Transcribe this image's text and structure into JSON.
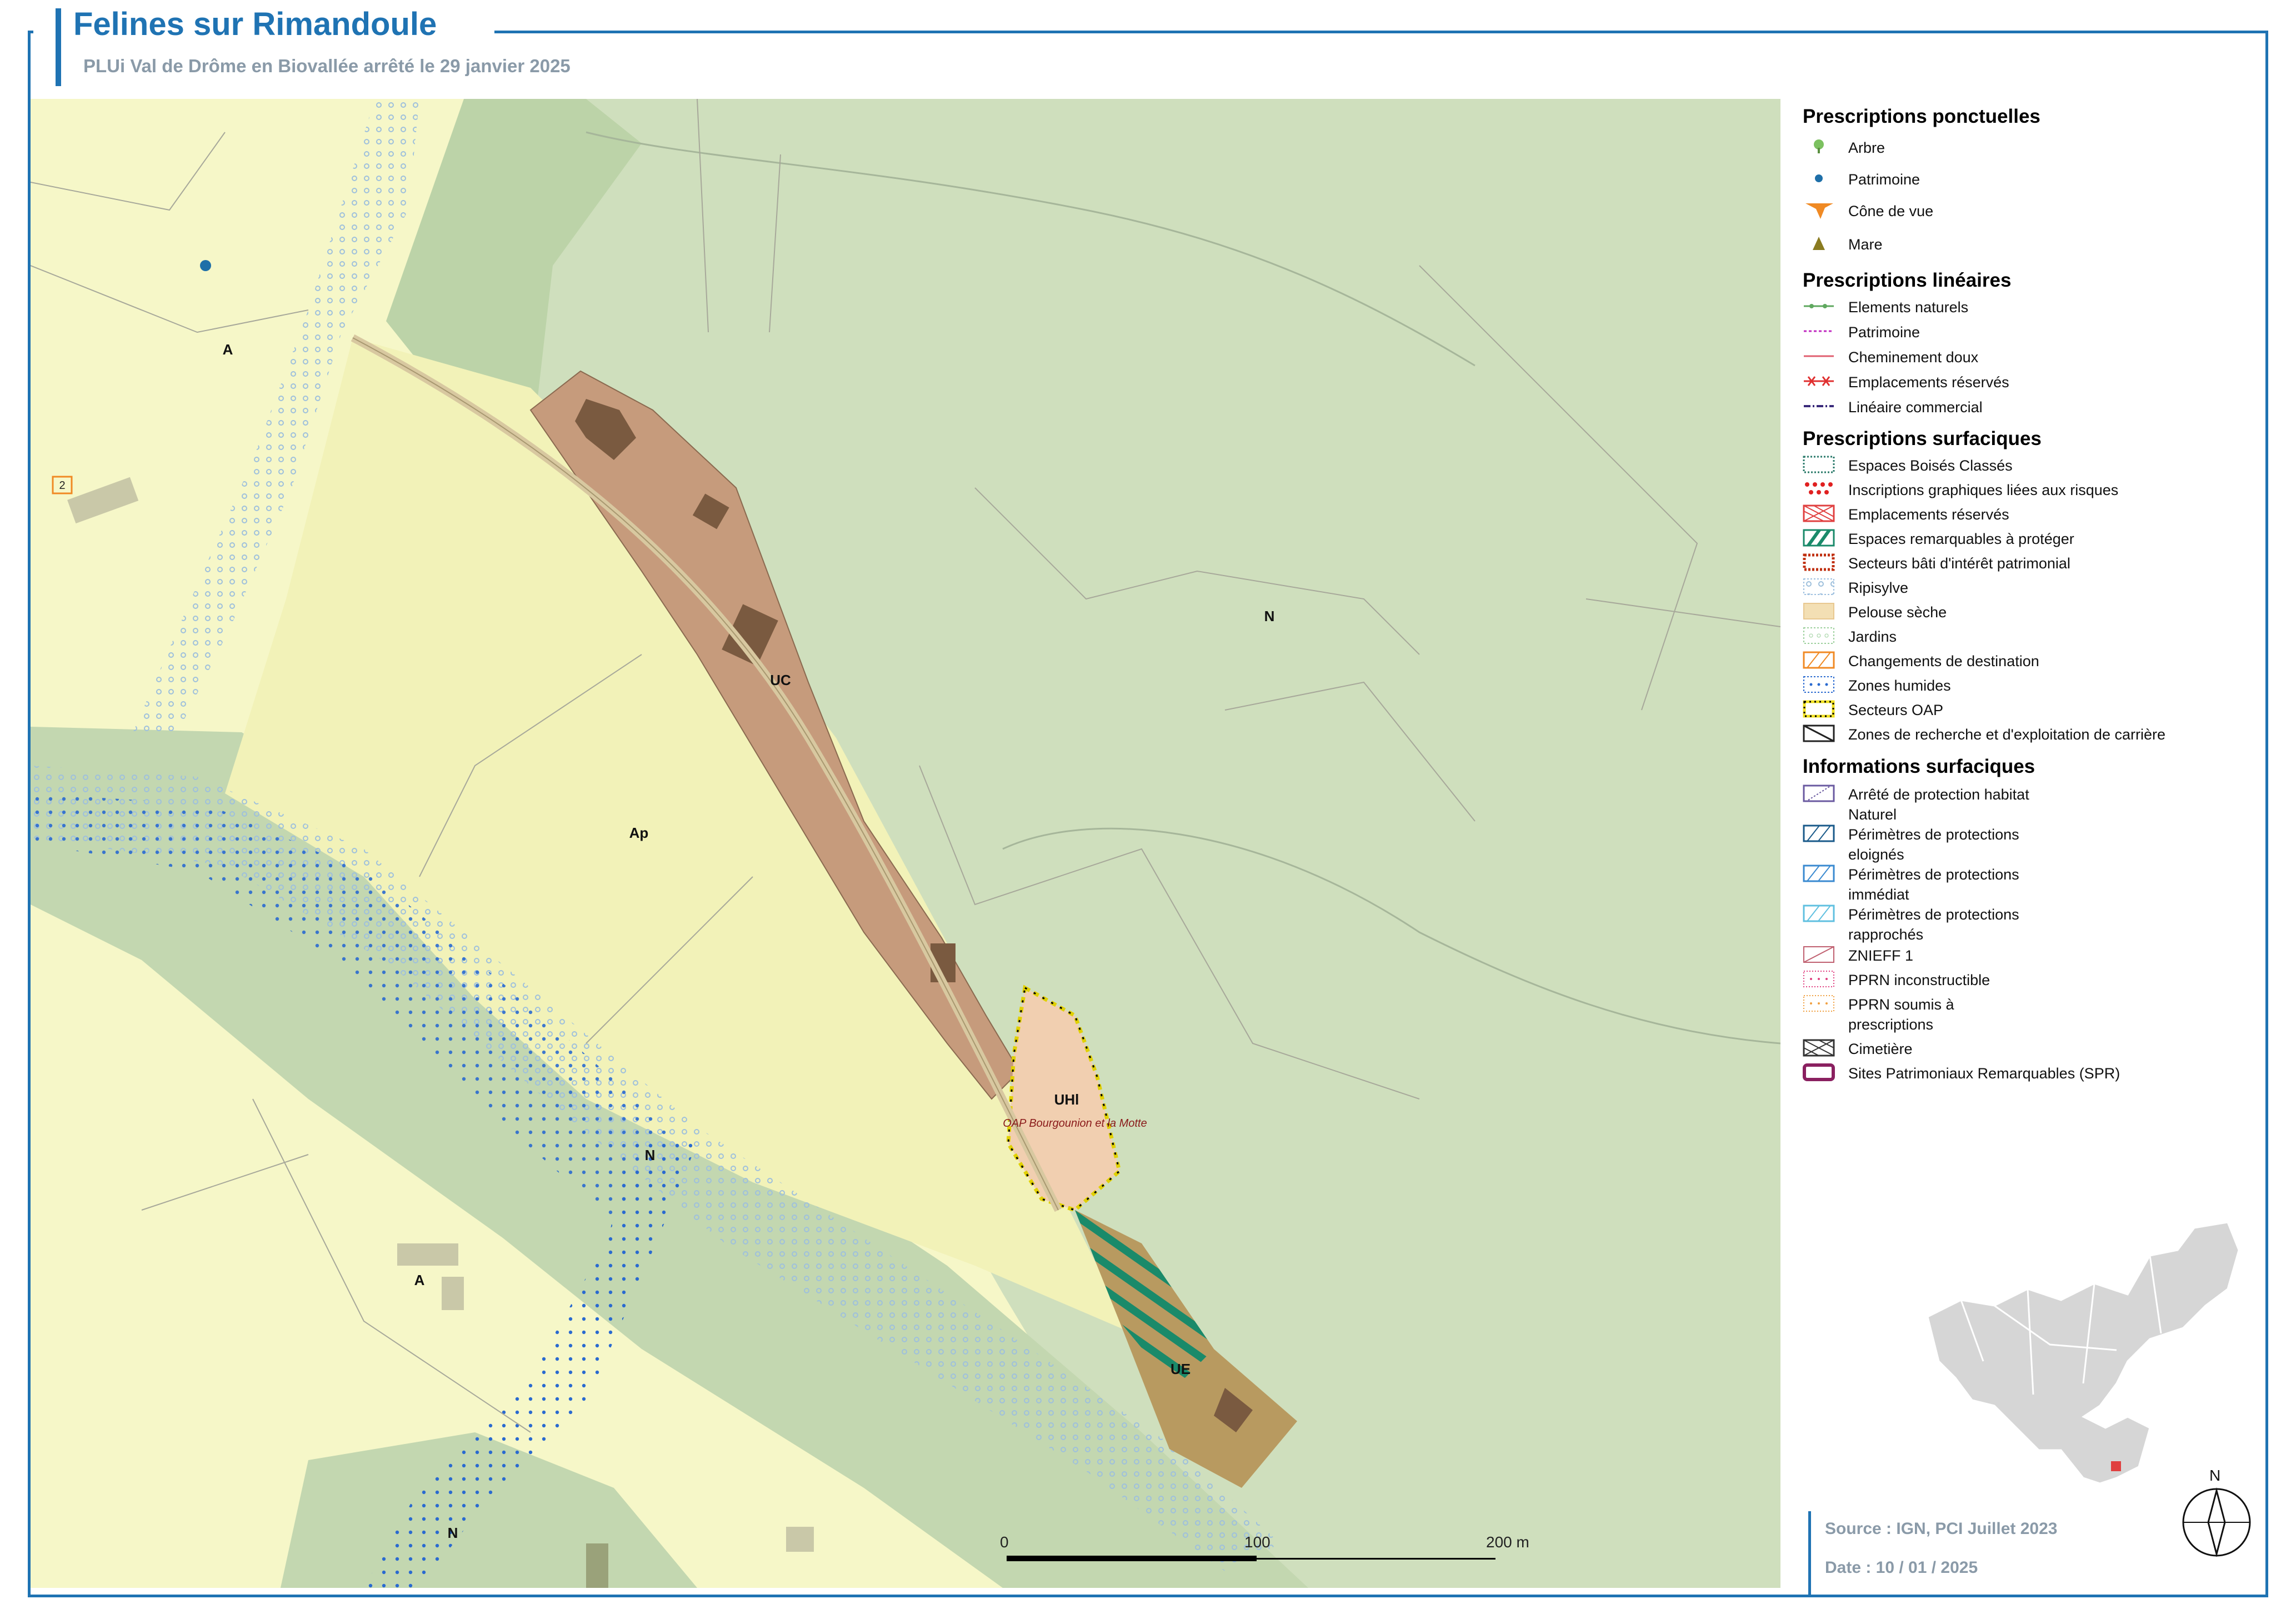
{
  "header": {
    "title": "Felines sur Rimandoule",
    "subtitle": "PLUi Val de Drôme en Biovallée arrêté le 29 janvier 2025"
  },
  "map": {
    "zones": [
      {
        "code": "A",
        "color": "#f6f7c8"
      },
      {
        "code": "Ap",
        "color": "#f2f2b8"
      },
      {
        "code": "N",
        "color": "#cfdfbd"
      },
      {
        "code": "UC",
        "color": "#c69b7c"
      },
      {
        "code": "UHl",
        "color": "#f1cfb0"
      },
      {
        "code": "UE",
        "color": "#b89a60"
      }
    ],
    "zone_labels": [
      "A",
      "A",
      "Ap",
      "N",
      "N",
      "N",
      "UC",
      "UHl",
      "UE"
    ],
    "oap_label": "OAP Bourgounion et la Motte",
    "parcel_badge": "2",
    "scale": {
      "labels": [
        "0",
        "100",
        "200 m"
      ]
    }
  },
  "legend": {
    "sections": [
      {
        "title": "Prescriptions ponctuelles",
        "items": [
          {
            "label": "Arbre",
            "icon": "tree-icon",
            "color": "#7cc160"
          },
          {
            "label": "Patrimoine",
            "icon": "dot-icon",
            "color": "#1e6fa8"
          },
          {
            "label": "Cône de vue",
            "icon": "view-cone-icon",
            "color": "#f08a24"
          },
          {
            "label": "Mare",
            "icon": "triangle-icon",
            "color": "#8a7b20"
          }
        ]
      },
      {
        "title": "Prescriptions linéaires",
        "items": [
          {
            "label": "Elements naturels",
            "icon": "line-dotted-icon",
            "color": "#5fa85f"
          },
          {
            "label": "Patrimoine",
            "icon": "line-dashed-icon",
            "color": "#c02cc0"
          },
          {
            "label": "Cheminement doux",
            "icon": "line-solid-icon",
            "color": "#e06070"
          },
          {
            "label": "Emplacements réservés",
            "icon": "line-cross-icon",
            "color": "#e03030"
          },
          {
            "label": "Linéaire commercial",
            "icon": "line-dashdot-icon",
            "color": "#3a2a7a"
          }
        ]
      },
      {
        "title": "Prescriptions surfaciques",
        "items": [
          {
            "label": "Espaces Boisés Classés",
            "icon": "ebc-icon",
            "color": "#2a7a6a"
          },
          {
            "label": "Inscriptions graphiques liées aux risques",
            "icon": "risk-dots-icon",
            "color": "#e02020"
          },
          {
            "label": "Emplacements réservés",
            "icon": "reserved-cross-icon",
            "color": "#e04040"
          },
          {
            "label": "Espaces remarquables à protéger",
            "icon": "remarkable-hatch-icon",
            "color": "#1a8a6a"
          },
          {
            "label": "Secteurs bâti d'intérêt patrimonial",
            "icon": "heritage-sector-icon",
            "color": "#c03010"
          },
          {
            "label": "Ripisylve",
            "icon": "ripisylve-icon",
            "color": "#9ec0e0"
          },
          {
            "label": "Pelouse sèche",
            "icon": "dry-lawn-icon",
            "color": "#e8c890"
          },
          {
            "label": "Jardins",
            "icon": "gardens-icon",
            "color": "#9cd09c"
          },
          {
            "label": "Changements de destination",
            "icon": "destination-change-icon",
            "color": "#f08a24"
          },
          {
            "label": "Zones humides",
            "icon": "wetland-icon",
            "color": "#2a6ad0"
          },
          {
            "label": "Secteurs OAP",
            "icon": "oap-icon",
            "color": "#f0e020"
          },
          {
            "label": "Zones de recherche et d'exploitation de carrière",
            "icon": "quarry-icon",
            "color": "#222222"
          }
        ]
      },
      {
        "title": "Informations surfaciques",
        "items": [
          {
            "label": "Arrêté de protection habitat Naturel",
            "icon": "habitat-protection-icon",
            "color": "#6a5aa0"
          },
          {
            "label": "Périmètres de protections eloignés",
            "icon": "far-protection-icon",
            "color": "#1a5a8a"
          },
          {
            "label": "Périmètres de protections immédiat",
            "icon": "immediate-protection-icon",
            "color": "#3a8ad0"
          },
          {
            "label": "Périmètres de protections rapprochés",
            "icon": "close-protection-icon",
            "color": "#60c0e0"
          },
          {
            "label": "ZNIEFF 1",
            "icon": "znieff-icon",
            "color": "#c06070"
          },
          {
            "label": "PPRN inconstructible",
            "icon": "pprn-unbuildable-icon",
            "color": "#e04080"
          },
          {
            "label": "PPRN soumis à prescriptions",
            "icon": "pprn-prescriptions-icon",
            "color": "#f0a040"
          },
          {
            "label": "Cimetière",
            "icon": "cemetery-icon",
            "color": "#333333"
          },
          {
            "label": "Sites Patrimoniaux Remarquables (SPR)",
            "icon": "spr-icon",
            "color": "#8a2060"
          }
        ]
      }
    ]
  },
  "info": {
    "source": "Source : IGN, PCI Juillet 2023",
    "date": "Date : 10 / 01 / 2025"
  },
  "north": {
    "label": "N"
  }
}
